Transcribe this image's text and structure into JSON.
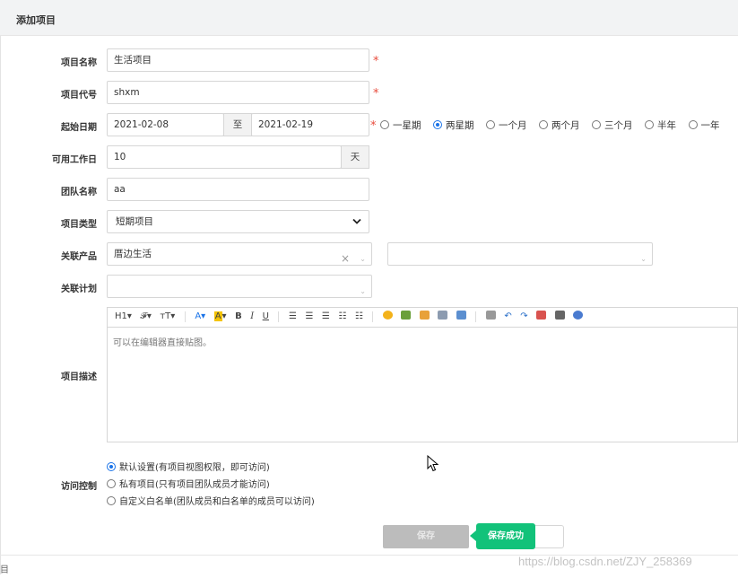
{
  "header": {
    "title": "添加项目"
  },
  "form": {
    "name": {
      "label": "项目名称",
      "value": "生活项目",
      "required": "*"
    },
    "code": {
      "label": "项目代号",
      "value": "shxm",
      "required": "*"
    },
    "dates": {
      "label": "起始日期",
      "start": "2021-02-08",
      "separator": "至",
      "end": "2021-02-19",
      "required": "*",
      "presets": [
        "一星期",
        "两星期",
        "一个月",
        "两个月",
        "三个月",
        "半年",
        "一年"
      ],
      "selected_preset": "两星期"
    },
    "workdays": {
      "label": "可用工作日",
      "value": "10",
      "unit": "天"
    },
    "team": {
      "label": "团队名称",
      "value": "aa"
    },
    "type": {
      "label": "项目类型",
      "value": "短期项目"
    },
    "product": {
      "label": "关联产品",
      "value": "厝边生活",
      "clear": "×",
      "caret": "⌄"
    },
    "plan": {
      "label": "关联计划",
      "value": ""
    },
    "description": {
      "label": "项目描述",
      "placeholder": "可以在编辑器直接贴图。",
      "toolbar": [
        "H1",
        "𝓕",
        "тT",
        "A",
        "A",
        "B",
        "I",
        "U"
      ]
    },
    "access": {
      "label": "访问控制",
      "options": [
        "默认设置(有项目视图权限，即可访问)",
        "私有项目(只有项目团队成员才能访问)",
        "自定义白名单(团队成员和白名单的成员可以访问)"
      ],
      "selected": 0
    }
  },
  "actions": {
    "save_label": "保存",
    "toast": "保存成功"
  },
  "footer": {
    "watermark": "https://blog.csdn.net/ZJY_258369",
    "stub": "目"
  },
  "colors": {
    "accent": "#1a73e8",
    "required": "#e84c3d",
    "toast": "#12c27a",
    "disabled": "#bcbcbc"
  }
}
